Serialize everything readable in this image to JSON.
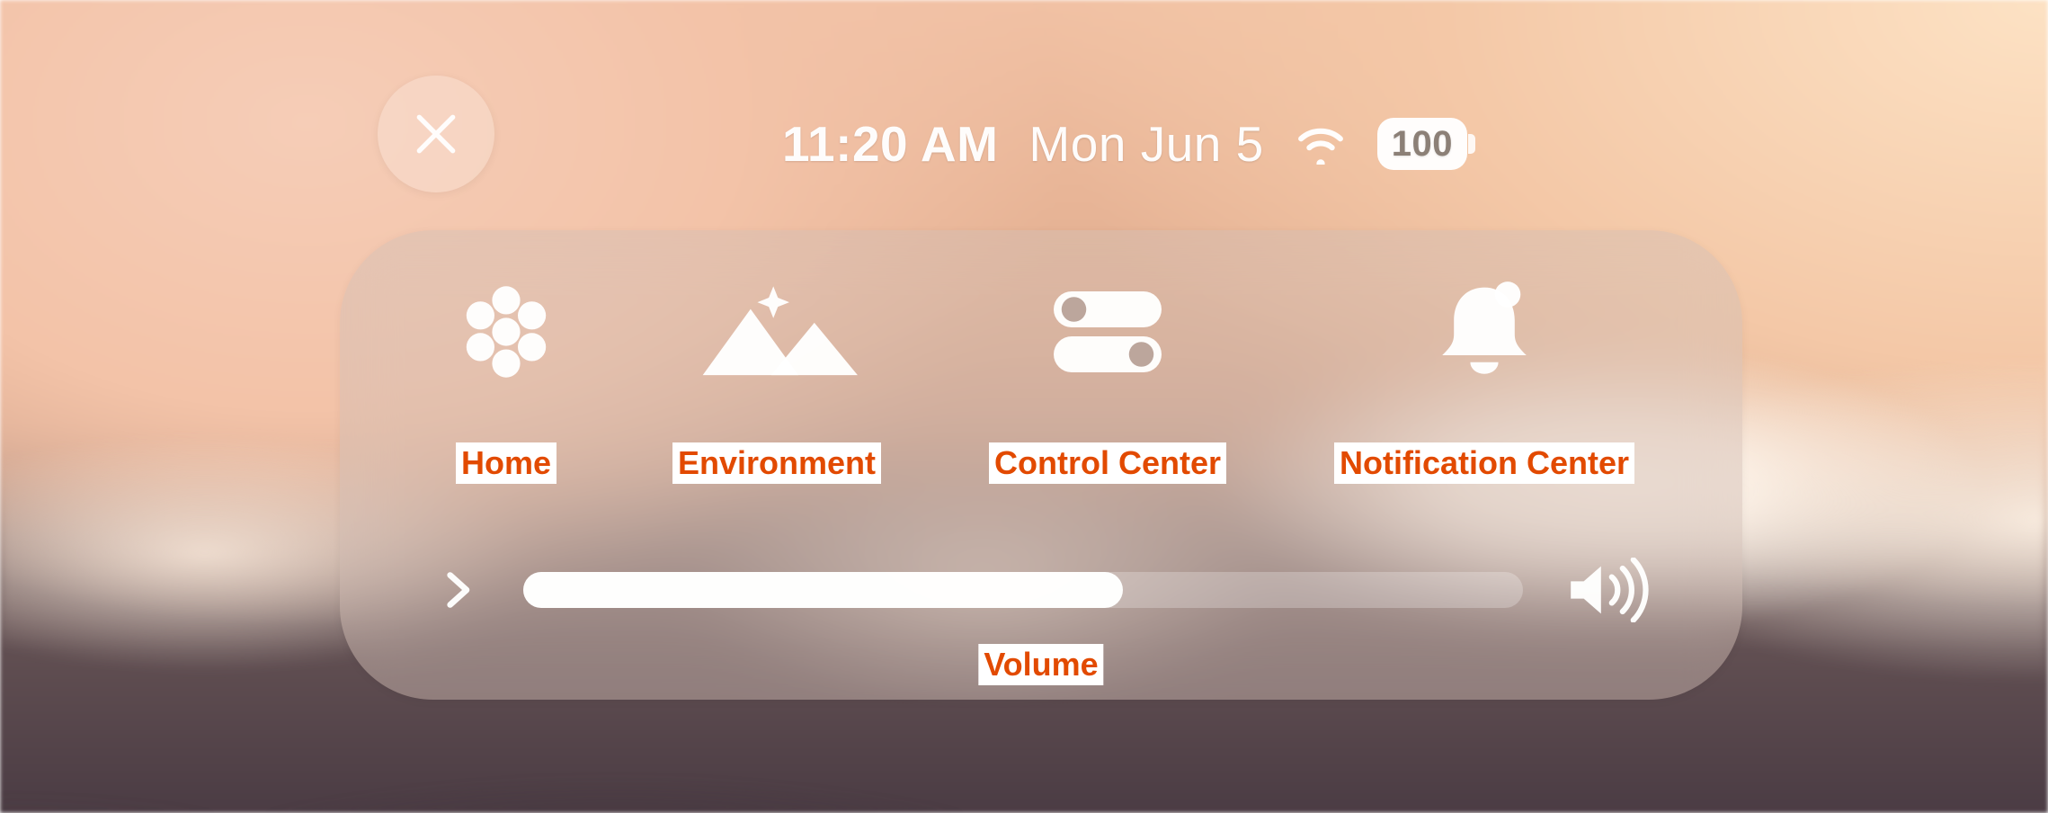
{
  "statusbar": {
    "time": "11:20 AM",
    "date": "Mon Jun 5",
    "wifi_icon": "wifi-icon",
    "battery_level": "100"
  },
  "close_button": {
    "icon": "close-icon"
  },
  "panel": {
    "items": [
      {
        "name": "home",
        "icon": "home-cluster-icon",
        "label": "Home"
      },
      {
        "name": "environment",
        "icon": "mountains-sparkle-icon",
        "label": "Environment"
      },
      {
        "name": "control-center",
        "icon": "toggles-icon",
        "label": "Control Center"
      },
      {
        "name": "notification-center",
        "icon": "bell-icon",
        "label": "Notification Center"
      }
    ],
    "volume": {
      "chevron_icon": "chevron-right-icon",
      "label": "Volume",
      "value_percent": 60,
      "speaker_icon": "speaker-icon"
    }
  }
}
